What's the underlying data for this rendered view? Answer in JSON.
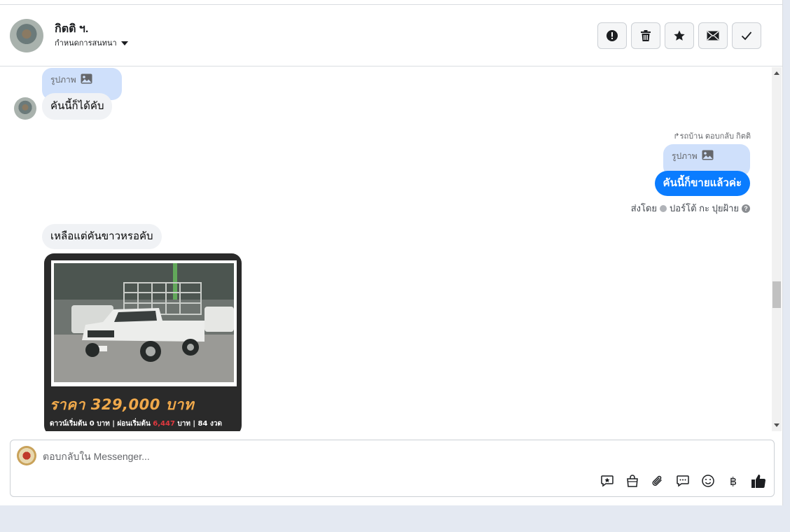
{
  "header": {
    "contact_name": "กิตติ ฯ.",
    "assign_label": "กำหนดการสนทนา",
    "actions": [
      {
        "name": "mark-spam-button",
        "icon": "alert-icon"
      },
      {
        "name": "delete-button",
        "icon": "trash-icon"
      },
      {
        "name": "star-button",
        "icon": "star-icon"
      },
      {
        "name": "mark-unread-button",
        "icon": "envelope-icon"
      },
      {
        "name": "mark-done-button",
        "icon": "check-icon"
      }
    ]
  },
  "messages": {
    "in_image_label": "รูปภาพ",
    "in_text_1": "คันนี้ก็ได้คับ",
    "reply_note": "รถบ้าน ตอบกลับ กิตติ",
    "out_image_label": "รูปภาพ",
    "out_text": "คันนี้ก็ขายแล้วค่ะ",
    "sent_by_prefix": "ส่งโดย",
    "sent_by_name": "ปอร์โต้ กะ ปุยฝ้าย",
    "help_glyph": "?",
    "in_text_2": "เหลือแต่คันขาวหรอคับ",
    "card_price": "ราคา 329,000 บาท",
    "card_finance_1": "ดาวน์เริ่มต้น 0 บาท | ผ่อนเริ่มต้น ",
    "card_finance_amount": "6,447",
    "card_finance_2": " บาท | 84 งวด"
  },
  "composer": {
    "placeholder": "ตอบกลับใน Messenger...",
    "tools": [
      {
        "name": "saved-reply-button",
        "icon": "chat-star-icon"
      },
      {
        "name": "shop-button",
        "icon": "shopping-bag-icon"
      },
      {
        "name": "attach-button",
        "icon": "paperclip-icon"
      },
      {
        "name": "faq-button",
        "icon": "chat-bubble-icon"
      },
      {
        "name": "emoji-button",
        "icon": "smiley-icon"
      },
      {
        "name": "payment-button",
        "icon": "baht-icon",
        "glyph": "฿"
      },
      {
        "name": "like-button",
        "icon": "thumbs-up-icon"
      }
    ]
  },
  "colors": {
    "outgoing_bubble": "#0a7cff",
    "image_ref_bubble": "#cfe0fb",
    "incoming_bubble": "#f0f2f5",
    "price_text": "#f0a94b",
    "finance_highlight": "#e0383e"
  }
}
